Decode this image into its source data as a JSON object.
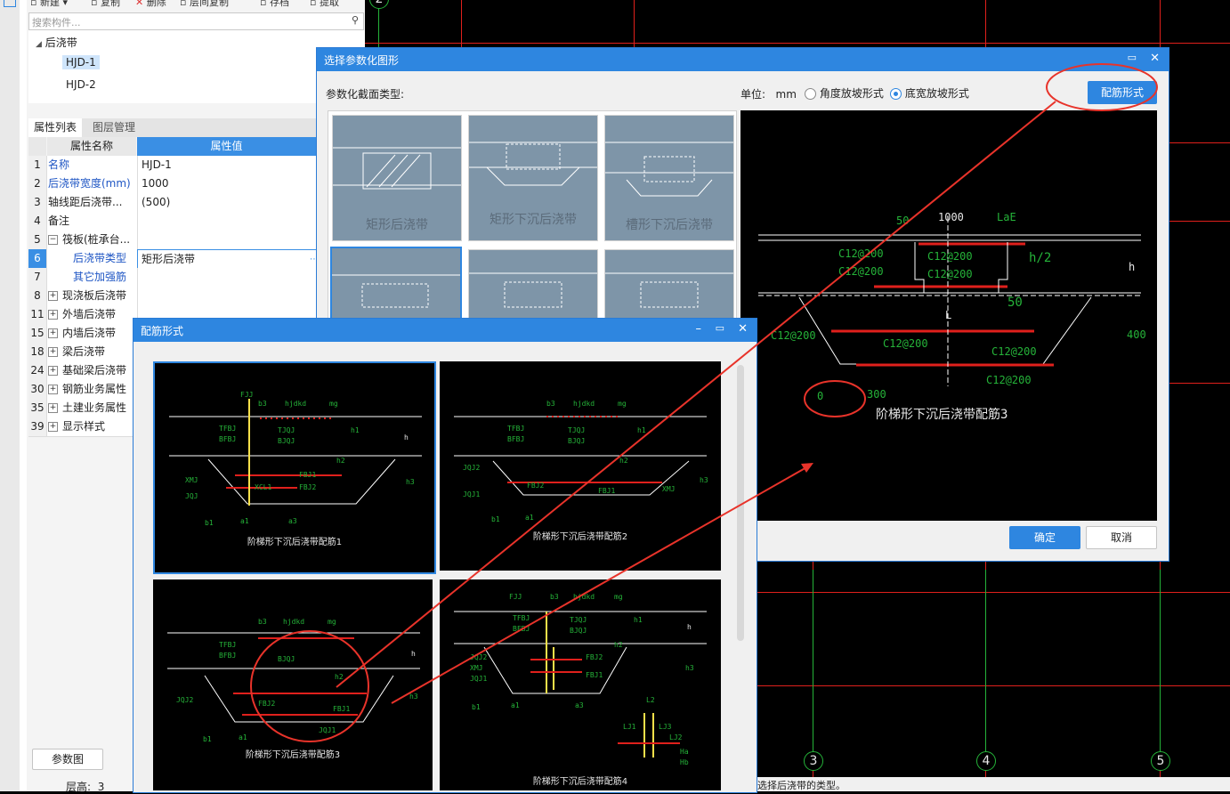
{
  "toolbar": {
    "new": "新建",
    "copy": "复制",
    "delete": "删除",
    "layer_copy": "层间复制",
    "save": "存档",
    "extract": "提取"
  },
  "search": {
    "placeholder": "搜索构件..."
  },
  "tree": {
    "root": "后浇带",
    "items": [
      "HJD-1",
      "HJD-2"
    ]
  },
  "tabs": [
    "属性列表",
    "图层管理"
  ],
  "props": {
    "header_name": "属性名称",
    "header_value": "属性值",
    "rows": [
      {
        "num": "1",
        "name": "名称",
        "value": "HJD-1"
      },
      {
        "num": "2",
        "name": "后浇带宽度(mm)",
        "value": "1000"
      },
      {
        "num": "3",
        "name": "轴线距后浇带...",
        "value": "(500)"
      },
      {
        "num": "4",
        "name": "备注",
        "value": ""
      },
      {
        "num": "5",
        "name": "筏板(桩承台...",
        "value": ""
      },
      {
        "num": "6",
        "name": "后浇带类型",
        "value": "矩形后浇带"
      },
      {
        "num": "7",
        "name": "其它加强筋",
        "value": ""
      },
      {
        "num": "8",
        "name": "现浇板后浇带",
        "value": ""
      },
      {
        "num": "11",
        "name": "外墙后浇带",
        "value": ""
      },
      {
        "num": "15",
        "name": "内墙后浇带",
        "value": ""
      },
      {
        "num": "18",
        "name": "梁后浇带",
        "value": ""
      },
      {
        "num": "24",
        "name": "基础梁后浇带",
        "value": ""
      },
      {
        "num": "30",
        "name": "钢筋业务属性",
        "value": ""
      },
      {
        "num": "35",
        "name": "土建业务属性",
        "value": ""
      },
      {
        "num": "39",
        "name": "显示样式",
        "value": ""
      }
    ]
  },
  "param_button": "参数图",
  "floor": {
    "label": "层高:",
    "value": "3"
  },
  "dialog_select": {
    "title": "选择参数化图形",
    "section_label": "参数化截面类型:",
    "unit_label": "单位:",
    "unit": "mm",
    "radio1": "角度放坡形式",
    "radio2": "底宽放坡形式",
    "rebar_button": "配筋形式",
    "ok": "确定",
    "cancel": "取消",
    "thumbs": [
      "矩形后浇带",
      "矩形下沉后浇带",
      "槽形下沉后浇带"
    ],
    "preview": {
      "caption": "阶梯形下沉后浇带配筋3",
      "dims": [
        "50",
        "1000",
        "LaE",
        "h/2",
        "h",
        "50",
        "L",
        "400",
        "0",
        "300"
      ],
      "rebars": [
        "C12@200",
        "C12@200",
        "C12@200",
        "C12@200",
        "C12@200",
        "C12@200",
        "C12@200",
        "C12@200"
      ]
    }
  },
  "dialog_rebar": {
    "title": "配筋形式",
    "cards": [
      {
        "caption": "阶梯形下沉后浇带配筋1"
      },
      {
        "caption": "阶梯形下沉后浇带配筋2"
      },
      {
        "caption": "阶梯形下沉后浇带配筋3"
      },
      {
        "caption": "阶梯形下沉后浇带配筋4"
      }
    ],
    "labels": {
      "fjj": "FJJ",
      "b3": "b3",
      "hjdkd": "hjdkd",
      "mg": "mg",
      "tfbj": "TFBJ",
      "bfbj": "BFBJ",
      "tjqj": "TJQJ",
      "bjqj": "BJQJ",
      "h1": "h1",
      "h2": "h2",
      "h": "h",
      "h3": "h3",
      "fbj1": "FBJ1",
      "fbj2": "FBJ2",
      "xmj": "XMJ",
      "jqj": "JQJ",
      "jqj1": "JQJ1",
      "jqj2": "JQJ2",
      "xcl1": "XCL1",
      "b1": "b1",
      "a1": "a1",
      "a3": "a3",
      "lj1": "LJ1",
      "lj2": "LJ2",
      "lj3": "LJ3",
      "ha": "Ha",
      "hb": "Hb",
      "l2": "L2"
    }
  },
  "status_text": "选择后浇带的类型。",
  "grid_bubbles": [
    "2",
    "3",
    "4",
    "5"
  ],
  "colors": {
    "accent": "#2e86e0",
    "cad_red": "#e0201c",
    "cad_green": "#25b339",
    "annotation_red": "#e8332a"
  }
}
